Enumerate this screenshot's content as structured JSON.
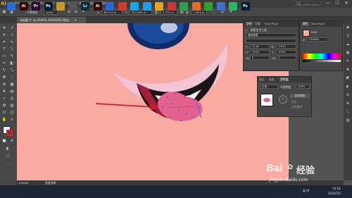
{
  "app": {
    "logo": "Ai"
  },
  "menubar": {
    "items": [
      "文件(F)",
      "编辑(E)",
      "对象(O)",
      "文字(T)",
      "选择(S)",
      "效果(C)",
      "视图(V)",
      "窗口(W)",
      "帮助(H)"
    ],
    "search_placeholder": "搜索 Adobe Stock",
    "window_buttons": [
      "—",
      "☐",
      "✕"
    ]
  },
  "control_bar": {
    "opacity_label": "不透明度",
    "opacity_value": "100%",
    "x_label": "X",
    "x_value": "48.701 m",
    "y_label": "Y",
    "y_value": "321.843 m",
    "w_label": "宽",
    "w_value": "2.772 m",
    "h_label": "高",
    "h_value": "1.624 m"
  },
  "document_tab": {
    "title": "未标题-1* @ 2400% (RGB/GPU 预览)",
    "close": "×"
  },
  "status_bar": {
    "zoom": "2400%",
    "tool": "直接选择"
  },
  "character_panel": {
    "tabs": [
      "字符",
      "段落",
      "OpenType"
    ],
    "font_search": "搜索文字工具",
    "font_family": "微软雅黑",
    "font_style": "",
    "size": "12 pt",
    "leading": "(16.9)",
    "h_scale": "100%",
    "v_scale": "100%",
    "tracking": "0",
    "kerning": "0"
  },
  "color_panel": {
    "tabs": [
      "颜色",
      "OpenType"
    ],
    "hex": "F9A9A6",
    "mode": "RGB"
  },
  "transparency_panel": {
    "tabs": [
      "描边",
      "渐变",
      "透明度"
    ],
    "mode": "正常",
    "opacity_label": "不透明度",
    "opacity_value": "100%",
    "make_mask_button": "制作蒙版",
    "clip_label": "剪切",
    "invert_label": "反相蒙版"
  },
  "taskbar": {
    "apps": [
      {
        "label": "",
        "color": "#2f6bd6"
      },
      {
        "label": "Ai",
        "color": "#330000"
      },
      {
        "label": "Pr",
        "color": "#2a0634"
      },
      {
        "label": "Ps",
        "color": "#001d34"
      },
      {
        "label": "",
        "color": "#c89a2a"
      },
      {
        "label": "",
        "color": "#555555"
      },
      {
        "label": "Lr",
        "color": "#0b2a3a"
      },
      {
        "label": "Ai",
        "color": "#330000"
      },
      {
        "label": "",
        "color": "#2b66d9"
      },
      {
        "label": "",
        "color": "#d43a2a"
      },
      {
        "label": "",
        "color": "#1aa3e8"
      },
      {
        "label": "",
        "color": "#1f9bf0"
      },
      {
        "label": "",
        "color": "#e8a21a"
      },
      {
        "label": "",
        "color": "#c93838"
      },
      {
        "label": "",
        "color": "#2aa14a"
      },
      {
        "label": "",
        "color": "#e66b2a"
      },
      {
        "label": "",
        "color": "#2ca02c"
      },
      {
        "label": "",
        "color": "#3c6fd1"
      },
      {
        "label": "",
        "color": "#2ab36a"
      },
      {
        "label": "Ps",
        "color": "#001d34"
      }
    ],
    "clock_time": "14:18",
    "clock_date": "2020/5/5",
    "tray_text": "英 拼"
  },
  "watermark": {
    "brand": "Bai",
    "brand_cn": "经验",
    "url": "jingyan.baidu.com"
  },
  "colors": {
    "canvas": "#f9aaa2",
    "accent_ai": "#f7a600",
    "arrow": "#c8232c",
    "tongue": "#e4608d",
    "eye": "#0f2c66"
  }
}
